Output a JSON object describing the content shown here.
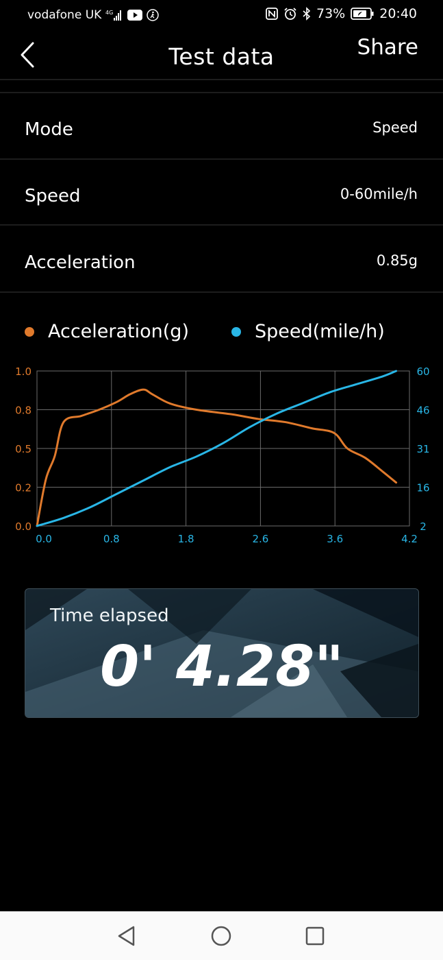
{
  "status_bar": {
    "carrier": "vodafone UK",
    "network": "4G",
    "battery": "73%",
    "time": "20:40"
  },
  "header": {
    "title": "Test data",
    "share_label": "Share"
  },
  "rows": [
    {
      "label": "Mode",
      "value": "Speed"
    },
    {
      "label": "Speed",
      "value": "0-60mile/h"
    },
    {
      "label": "Acceleration",
      "value": "0.85g"
    }
  ],
  "legend": {
    "acceleration": "Acceleration(g)",
    "speed": "Speed(mile/h)"
  },
  "colors": {
    "acceleration": "#e07a2c",
    "speed": "#29b6e6",
    "grid": "#6b6b6b"
  },
  "chart_data": {
    "type": "line",
    "x_ticks": [
      "0.0",
      "0.8",
      "1.8",
      "2.6",
      "3.6",
      "4.2"
    ],
    "y_left_ticks": [
      "0.0",
      "0.2",
      "0.5",
      "0.8",
      "1.0"
    ],
    "y_right_ticks": [
      "2",
      "16",
      "31",
      "46",
      "60"
    ],
    "xlim": [
      0,
      4.2
    ],
    "y_left_lim": [
      0,
      1.0
    ],
    "y_right_lim": [
      2,
      60
    ],
    "grid": true,
    "series": [
      {
        "name": "Acceleration(g)",
        "axis": "left",
        "x": [
          0.0,
          0.1,
          0.2,
          0.3,
          0.5,
          0.7,
          0.9,
          1.05,
          1.2,
          1.3,
          1.5,
          1.8,
          2.2,
          2.5,
          2.8,
          3.1,
          3.35,
          3.5,
          3.7,
          3.9,
          4.05
        ],
        "y": [
          0.0,
          0.3,
          0.45,
          0.67,
          0.71,
          0.75,
          0.8,
          0.85,
          0.88,
          0.85,
          0.79,
          0.75,
          0.72,
          0.69,
          0.67,
          0.63,
          0.6,
          0.5,
          0.44,
          0.35,
          0.28
        ]
      },
      {
        "name": "Speed(mile/h)",
        "axis": "right",
        "x": [
          0.0,
          0.3,
          0.6,
          0.9,
          1.2,
          1.5,
          1.8,
          2.1,
          2.4,
          2.7,
          3.0,
          3.3,
          3.6,
          3.9,
          4.05
        ],
        "y": [
          2,
          5,
          9,
          14,
          19,
          24,
          28,
          33,
          39,
          44,
          48,
          52,
          55,
          58,
          60
        ]
      }
    ]
  },
  "timer": {
    "label": "Time elapsed",
    "value": "0' 4.28\""
  }
}
